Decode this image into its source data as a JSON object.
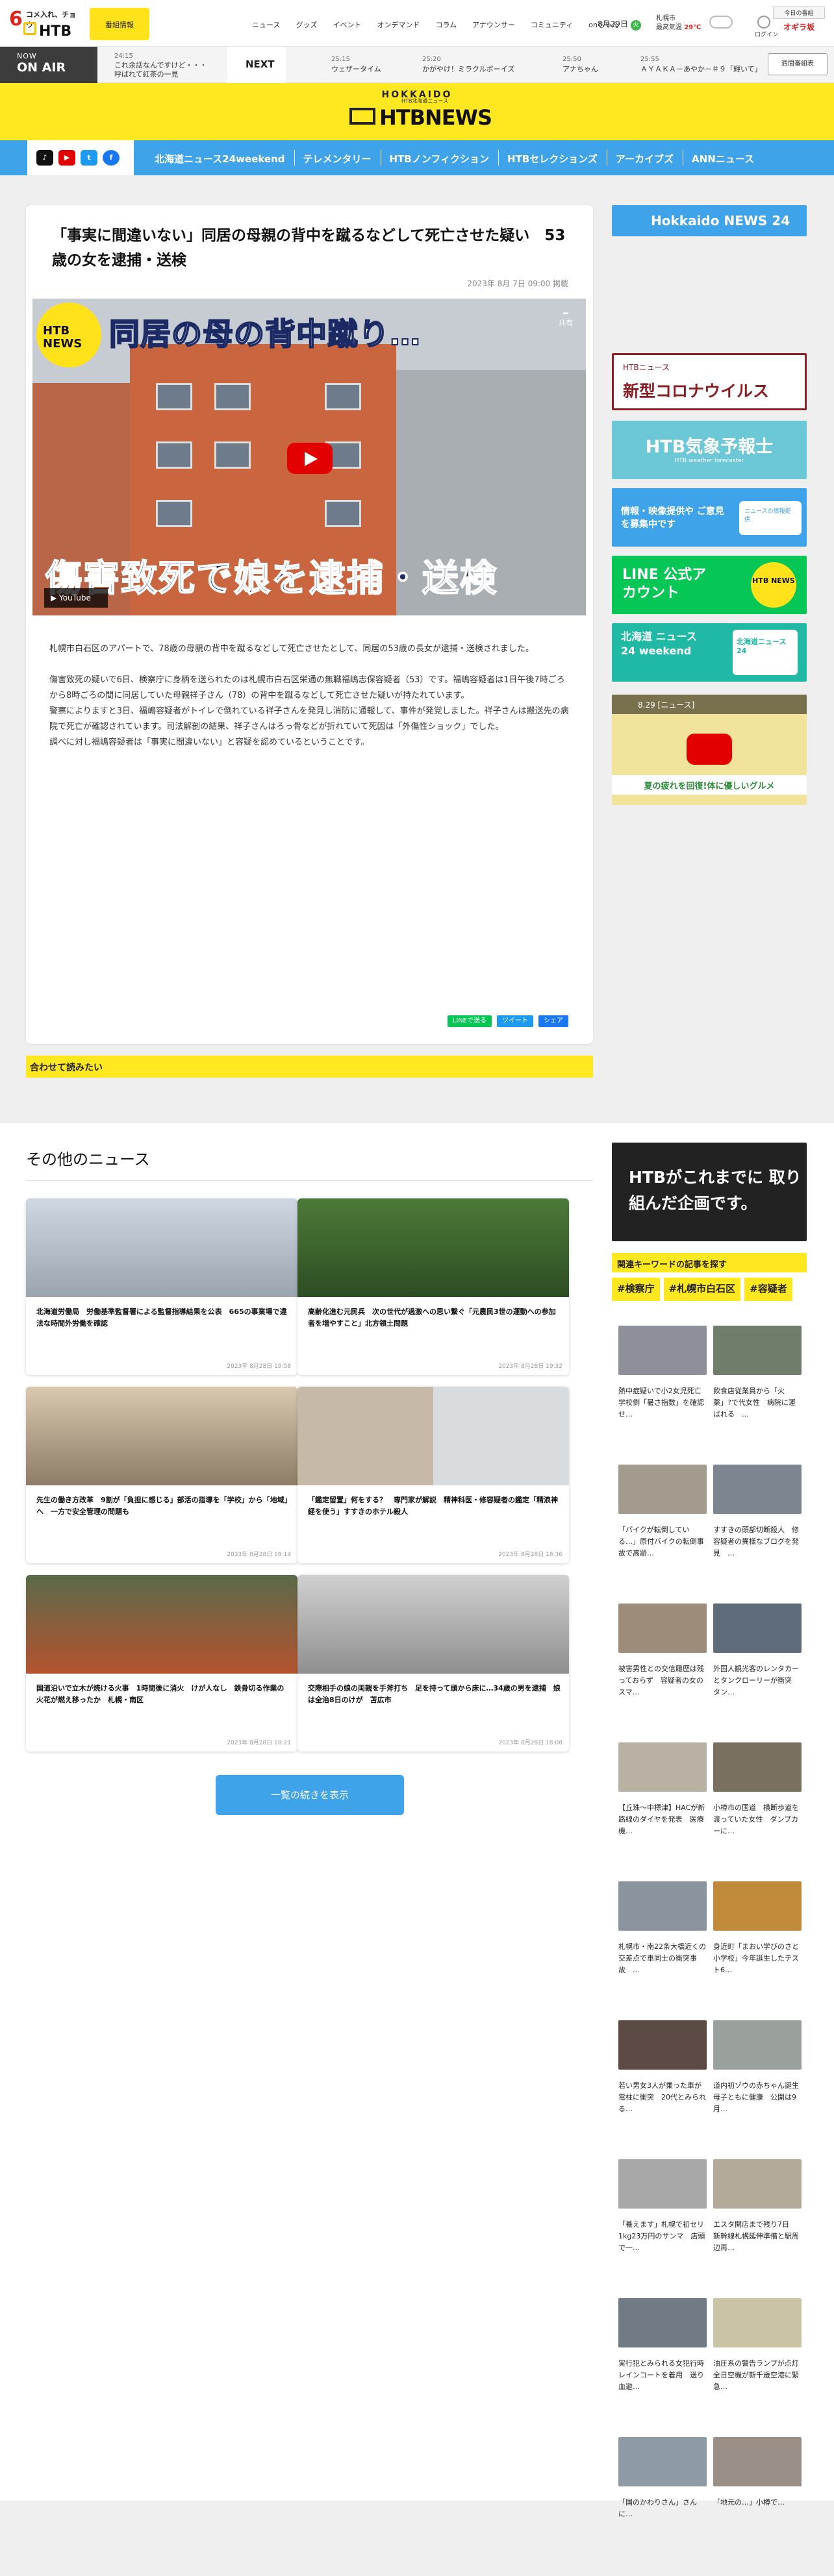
{
  "header": {
    "logo_top": "コメ入れ、チョウ",
    "logo_text": "HTB",
    "program_info": "番組情報",
    "nav": [
      "ニュース",
      "グッズ",
      "イベント",
      "オンデマンド",
      "コラム",
      "アナウンサー",
      "コミュニティ",
      "onちゃん"
    ],
    "date": "8月29日",
    "date_badge": "火",
    "weather_city": "札幌市",
    "weather_label": "最高気温",
    "weather_temp": "29℃",
    "user_label": "ログイン",
    "next_box_top": "今日の番組",
    "next_box_name": "オギラ坂"
  },
  "onair": {
    "now_small": "NOW",
    "now_large": "ON AIR",
    "current_time": "24:15",
    "current_title": "これ余話なんですけど・・・ 呼ばれて紅茶の一見",
    "next_label": "NEXT",
    "programs": [
      {
        "time": "25:15",
        "title": "ウェザータイム"
      },
      {
        "time": "25:20",
        "title": "かがやけ！ミラクルボーイズ"
      },
      {
        "time": "25:50",
        "title": "アナちゃん"
      },
      {
        "time": "25:55",
        "title": "ＡＹＡＫＡ－あやか－＃９「輝いて」"
      }
    ],
    "schedule_button": "週間番組表"
  },
  "brand": {
    "hokkaido": "HOKKAIDO",
    "htb_news_sub": "HTB北海道ニュース",
    "htb_news": "HTBNEWS"
  },
  "social": [
    "tiktok-icon",
    "youtube-icon",
    "twitter-icon",
    "facebook-icon"
  ],
  "nav": [
    "北海道ニュース24weekend",
    "テレメンタリー",
    "HTBノンフィクション",
    "HTBセレクションズ",
    "アーカイブズ",
    "ANNニュース"
  ],
  "article": {
    "title": "「事実に間違いない」同居の母親の背中を蹴るなどして死亡させた疑い　53歳の女を逮捕・送検",
    "published": "2023年 8月 7日 09:00 掲載",
    "video_top": "同居の母の背中蹴り…",
    "video_bottom": "傷害致死で娘を逮捕・送検",
    "video_logo": "HTB NEWS",
    "youtube_label": "YouTube",
    "share_label": "共有",
    "paragraphs": [
      "札幌市白石区のアパートで、78歳の母親の背中を蹴るなどして死亡させたとして、同居の53歳の長女が逮捕・送検されました。",
      "傷害致死の疑いで6日、検察庁に身柄を送られたのは札幌市白石区栄通の無職福嶋志保容疑者（53）です。福嶋容疑者は1日午後7時ごろから8時ごろの間に同居していた母親祥子さん（78）の背中を蹴るなどして死亡させた疑いが持たれています。\n警察によりますと3日、福嶋容疑者がトイレで倒れている祥子さんを発見し消防に通報して、事件が発覚しました。祥子さんは搬送先の病院で死亡が確認されています。司法解剖の結果、祥子さんはろっ骨などが折れていて死因は「外傷性ショック」でした。\n調べに対し福嶋容疑者は「事実に間違いない」と容疑を認めているということです。"
    ],
    "share_buttons": [
      "LINEで送る",
      "ツイート",
      "シェア"
    ]
  },
  "related_label": "合わせて読みたい",
  "other_news": {
    "heading": "その他のニュース",
    "items": [
      {
        "caption": "北海道労働局　労働基準監督署による監督指導結果を公表　665の事業場で違法な時間外労働を確認",
        "date": "2023年 8月28日 19:58"
      },
      {
        "caption": "高齢化進む元民兵　次の世代が過激への思い繋ぐ「元農民3世の運動への参加者を増やすこと」北方領土問題",
        "date": "2023年 8月28日 19:32"
      },
      {
        "caption": "先生の働き方改革　9割が「負担に感じる」部活の指導を「学校」から「地域」へ　一方で安全管理の問題も",
        "date": "2023年 8月28日 19:14"
      },
      {
        "caption": "「鑑定留置」何をする？　専門家が解説　精神科医・修容疑者の鑑定「精浪神経を使う」すすきのホテル殺人",
        "date": "2023年 8月28日 18:36"
      },
      {
        "caption": "国道沿いで立木が焼ける火事　1時間後に消火　けが人なし　鉄骨切る作業の火花が燃え移ったか　札幌・南区",
        "date": "2023年 8月28日 18:21"
      },
      {
        "caption": "交際相手の娘の両親を手斧打ち　足を持って頭から床に…34歳の男を逮捕　娘は全治8日のけが　苫広市",
        "date": "2023年 8月28日 18:08"
      }
    ],
    "more_button": "一覧の続きを表示"
  },
  "sidebar": {
    "banners": [
      {
        "name": "hokkaido-news24-banner",
        "text": "Hokkaido NEWS 24"
      },
      {
        "name": "corona-banner",
        "text_small": "HTBニュース",
        "text": "新型コロナウイルス"
      },
      {
        "name": "weather-forecaster-banner",
        "text": "HTB気象予報士",
        "text_small": "HTB weather forecaster"
      },
      {
        "name": "info-video-banner",
        "text": "情報・映像提供や ご意見を募集中です",
        "text_small": "ニュースの情報提供"
      },
      {
        "name": "line-banner",
        "text": "LINE 公式アカウント",
        "text_small": "HTB NEWS"
      },
      {
        "name": "news24weekend-banner",
        "text": "北海道 ニュース24 weekend",
        "text_small": "北海道ニュース24"
      },
      {
        "name": "video-banner",
        "text": "8.29 [ニュース]",
        "text_small": "夏の疲れを回復!体に優しいグルメ"
      }
    ],
    "htb_project_text": "HTBがこれまでに 取り組んだ企画です。",
    "keyword_label": "関連キーワードの記事を探す",
    "tags": [
      "#検察庁",
      "#札幌市白石区",
      "#容疑者"
    ],
    "side_news": [
      "熱中症疑いで小2女児死亡　学校側「暑さ指数」を確認せ…",
      "飲食店従業員から「火薬」?で代女性　病院に運ばれる　…",
      "「パイクが転倒している…」原付バイクの転倒事故で高齢…",
      "すすきの頭部切断殺人　修容疑者の異様なブログを発見　…",
      "被害男性との交信履歴は残っておらず　容疑者の女のスマ…",
      "外国人観光客のレンタカーとタンクローリーが衝突　タン…",
      "【丘珠〜中標津】HACが新路線のダイヤを発表　医療機…",
      "小樽市の国道　横断歩道を渡っていた女性　ダンプカーに…",
      "札幌市・南22条大橋近くの交差点で車同士の衝突事故　…",
      "身近町「まおい学びのさと小学校」今年誕生したテスト6…",
      "若い男女3人が乗った車が電柱に衝突　20代とみられる…",
      "道内初ゾウの赤ちゃん誕生　母子ともに健康　公開は9月…",
      "「養えます」札幌で初セリ1kg23万円のサンマ　店頭で一…",
      "エスタ開店まで残り7日　新幹線札幌延伸準備と駅周辺再…",
      "実行犯とみられる女犯行時レインコートを着用　送り血避…",
      "油圧系の警告ランプが点灯　全日空機が新千歳空港に緊急…",
      "「国のかわりさん」さんに…",
      "「地元の…」小樽で…"
    ]
  }
}
